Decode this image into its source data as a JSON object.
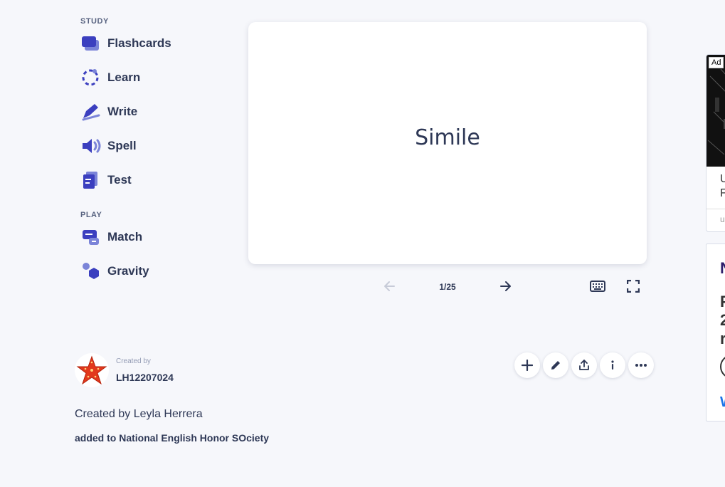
{
  "sidebar": {
    "study_label": "STUDY",
    "play_label": "PLAY",
    "study_items": [
      {
        "label": "Flashcards",
        "icon": "flashcards-icon"
      },
      {
        "label": "Learn",
        "icon": "learn-icon"
      },
      {
        "label": "Write",
        "icon": "write-icon"
      },
      {
        "label": "Spell",
        "icon": "spell-icon"
      },
      {
        "label": "Test",
        "icon": "test-icon"
      }
    ],
    "play_items": [
      {
        "label": "Match",
        "icon": "match-icon"
      },
      {
        "label": "Gravity",
        "icon": "gravity-icon"
      }
    ]
  },
  "card": {
    "term": "Simile",
    "counter": "1/25"
  },
  "creator": {
    "created_by_label": "Created by",
    "username": "LH12207024",
    "description": "Created by Leyla Herrera",
    "added_to": "added to National English Honor SOciety"
  },
  "ad": {
    "badge": "Ad",
    "text_line1": "U",
    "text_line2": "F",
    "small": "u"
  },
  "side_panel": {
    "heading": "N",
    "body_lines": [
      "F",
      "2",
      "r"
    ],
    "link": "W"
  },
  "colors": {
    "accent": "#4255ff",
    "icon_primary": "#3b3fbf",
    "icon_secondary": "#7b84d8",
    "background": "#f6f7fb",
    "text": "#2e3856"
  }
}
